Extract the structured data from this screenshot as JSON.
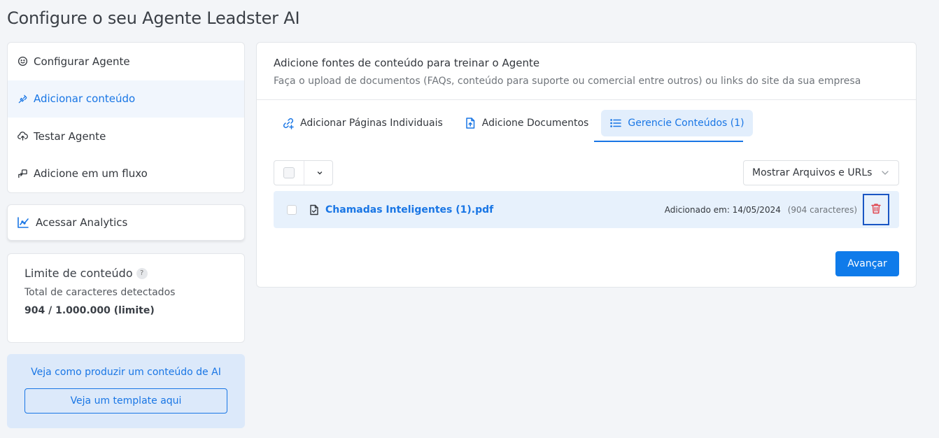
{
  "page": {
    "title": "Configure o seu Agente Leadster AI"
  },
  "sidebar": {
    "items": [
      {
        "label": "Configurar Agente",
        "icon": "smile-icon"
      },
      {
        "label": "Adicionar conteúdo",
        "icon": "plug-icon",
        "active": true
      },
      {
        "label": "Testar Agente",
        "icon": "cloud-upload-icon"
      },
      {
        "label": "Adicione em um fluxo",
        "icon": "flow-icon"
      }
    ],
    "analytics_label": "Acessar Analytics",
    "limit": {
      "title": "Limite de conteúdo",
      "help": "?",
      "subtitle": "Total de caracteres detectados",
      "value": "904 / 1.000.000 (limite)"
    },
    "tip": {
      "text": "Veja como produzir um conteúdo de AI",
      "button": "Veja um template aqui"
    }
  },
  "main": {
    "title": "Adicione fontes de conteúdo para treinar o Agente",
    "subtitle": "Faça o upload de documentos (FAQs, conteúdo para suporte ou comercial entre outros) ou links do site da sua empresa",
    "tabs": [
      {
        "label": "Adicionar Páginas Individuais",
        "icon": "link-add-icon"
      },
      {
        "label": "Adicione Documentos",
        "icon": "file-upload-icon"
      },
      {
        "label": "Gerencie Conteúdos (1)",
        "icon": "list-icon",
        "active": true
      }
    ],
    "filter": {
      "selected": "Mostrar Arquivos e URLs"
    },
    "files": [
      {
        "name": "Chamadas Inteligentes (1).pdf",
        "added": "Adicionado em: 14/05/2024",
        "chars": "(904 caracteres)"
      }
    ],
    "next_button": "Avançar"
  },
  "colors": {
    "accent": "#1976e5",
    "delete": "#e0454f",
    "highlight": "#1a56c4"
  }
}
